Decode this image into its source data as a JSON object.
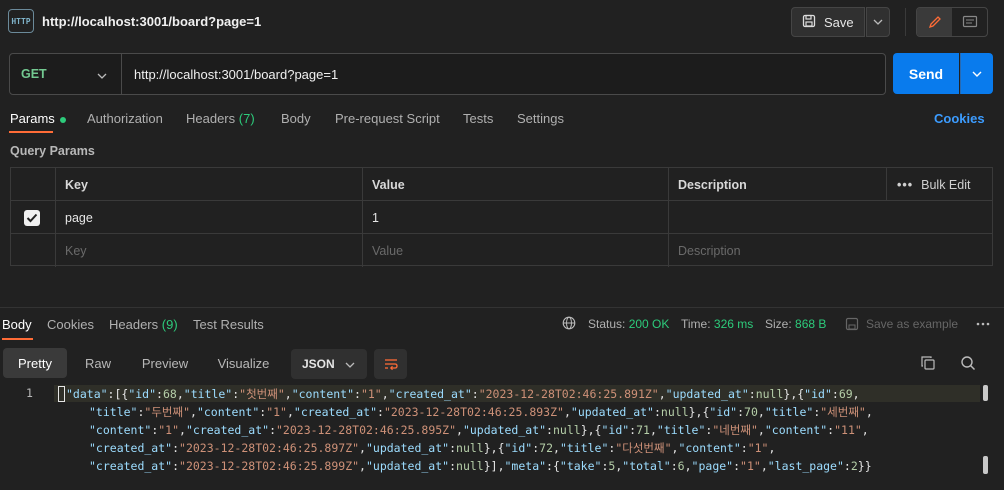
{
  "header": {
    "icon_text": "HTTP",
    "request_title": "http://localhost:3001/board?page=1",
    "save_label": "Save"
  },
  "url_bar": {
    "method": "GET",
    "url": "http://localhost:3001/board?page=1",
    "send_label": "Send"
  },
  "request_tabs": {
    "params": "Params",
    "authorization": "Authorization",
    "headers": "Headers",
    "headers_count": "(7)",
    "body": "Body",
    "prerequest": "Pre-request Script",
    "tests": "Tests",
    "settings": "Settings",
    "cookies": "Cookies"
  },
  "query_params": {
    "title": "Query Params",
    "headers": {
      "key": "Key",
      "value": "Value",
      "description": "Description",
      "bulk_edit": "Bulk Edit"
    },
    "rows": [
      {
        "checked": true,
        "key": "page",
        "value": "1",
        "description": ""
      }
    ],
    "placeholders": {
      "key": "Key",
      "value": "Value",
      "description": "Description"
    }
  },
  "response": {
    "tabs": {
      "body": "Body",
      "cookies": "Cookies",
      "headers": "Headers",
      "headers_count": "(9)",
      "test_results": "Test Results"
    },
    "status_label": "Status:",
    "status_value": "200 OK",
    "time_label": "Time:",
    "time_value": "326 ms",
    "size_label": "Size:",
    "size_value": "868 B",
    "save_example": "Save as example",
    "views": [
      "Pretty",
      "Raw",
      "Preview",
      "Visualize"
    ],
    "format": "JSON",
    "line_number": "1"
  },
  "colors": {
    "accent": "#ff6c37",
    "send": "#097bed",
    "method": "#73c991",
    "status_ok": "#2dcb7b",
    "link": "#3c9cff"
  }
}
